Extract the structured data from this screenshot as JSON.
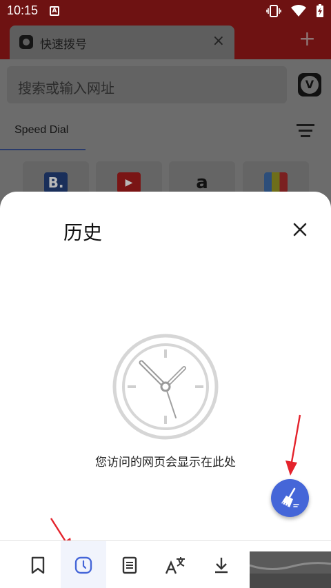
{
  "status_bar": {
    "time": "10:15",
    "notification_icon": "a-icon",
    "icons": [
      "vibrate-icon",
      "wifi-icon",
      "battery-icon"
    ]
  },
  "tab": {
    "title": "快速拨号",
    "close_symbol": "×",
    "new_tab_symbol": "+"
  },
  "url_bar": {
    "placeholder": "搜索或输入网址"
  },
  "speed_dial": {
    "label": "Speed Dial",
    "tiles": [
      {
        "name": "booking-tile",
        "glyph": "B.",
        "bg": "#1a2f5a",
        "fg": "#c8c8c8"
      },
      {
        "name": "youtube-tile",
        "glyph": "▶",
        "bg": "#7a1515",
        "fg": "#c8c8c8"
      },
      {
        "name": "amazon-tile",
        "glyph": "a",
        "bg": "transparent",
        "fg": "#111"
      },
      {
        "name": "shopping-tile",
        "glyph": "",
        "bg": "#2d4e7a",
        "fg": "#c8c8c8"
      }
    ]
  },
  "history_sheet": {
    "title": "历史",
    "empty_message": "您访问的网页会显示在此处"
  },
  "bottom_nav": {
    "items": [
      {
        "name": "bookmarks-nav-button",
        "icon": "bookmark-icon",
        "active": false
      },
      {
        "name": "history-nav-button",
        "icon": "history-clock-icon",
        "active": true
      },
      {
        "name": "notes-nav-button",
        "icon": "notes-icon",
        "active": false
      },
      {
        "name": "translate-nav-button",
        "icon": "translate-icon",
        "active": false
      },
      {
        "name": "downloads-nav-button",
        "icon": "download-icon",
        "active": false
      }
    ]
  },
  "colors": {
    "accent": "#4566d8",
    "annotation_red": "#e4232c",
    "header_red": "#6e1212"
  }
}
